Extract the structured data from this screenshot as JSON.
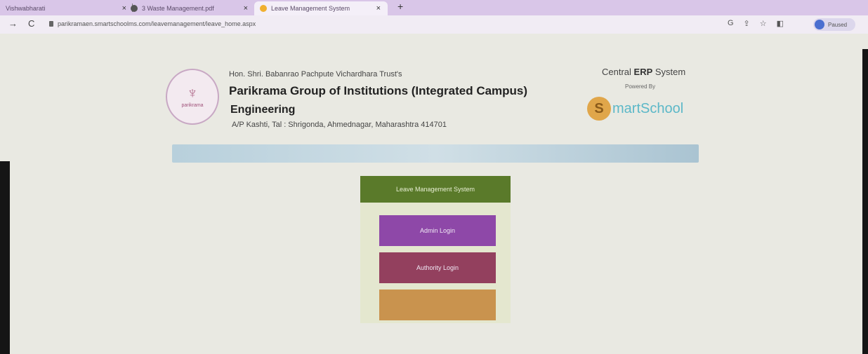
{
  "browser": {
    "tabs": [
      {
        "label": "Vishwabharati",
        "active": false
      },
      {
        "label": "3 Waste Management.pdf",
        "active": false
      },
      {
        "label": "Leave Management System",
        "active": true
      }
    ],
    "new_tab_label": "+",
    "close_label": "×",
    "back_label": "→",
    "reload_label": "C",
    "url": "parikramaen.smartschoolms.com/leavemanagement/leave_home.aspx",
    "profile_label": "Paused",
    "tool_icons": [
      "G",
      "⇪",
      "☆",
      "◧"
    ]
  },
  "header": {
    "trust": "Hon. Shri. Babanrao Pachpute Vichardhara Trust's",
    "institution": "Parikrama Group of Institutions (Integrated Campus)",
    "branch": "Engineering",
    "address": "A/P Kashti, Tal : Shrigonda, Ahmednagar, Maharashtra 414701",
    "logo_text": "parikrama",
    "erp_prefix": "Central ",
    "erp_bold": "ERP",
    "erp_suffix": " System",
    "powered_by": "Powered By",
    "brand_initial": "S",
    "brand_name": "martSchool"
  },
  "login_panel": {
    "title": "Leave Management System",
    "buttons": [
      {
        "label": "Admin Login",
        "color": "#8e48a8"
      },
      {
        "label": "Authority Login",
        "color": "#93405e"
      },
      {
        "label": "",
        "color": "#c9934e"
      }
    ]
  },
  "colors": {
    "panel_header": "#5a7a2a",
    "tab_strip": "#d9c6e8"
  }
}
